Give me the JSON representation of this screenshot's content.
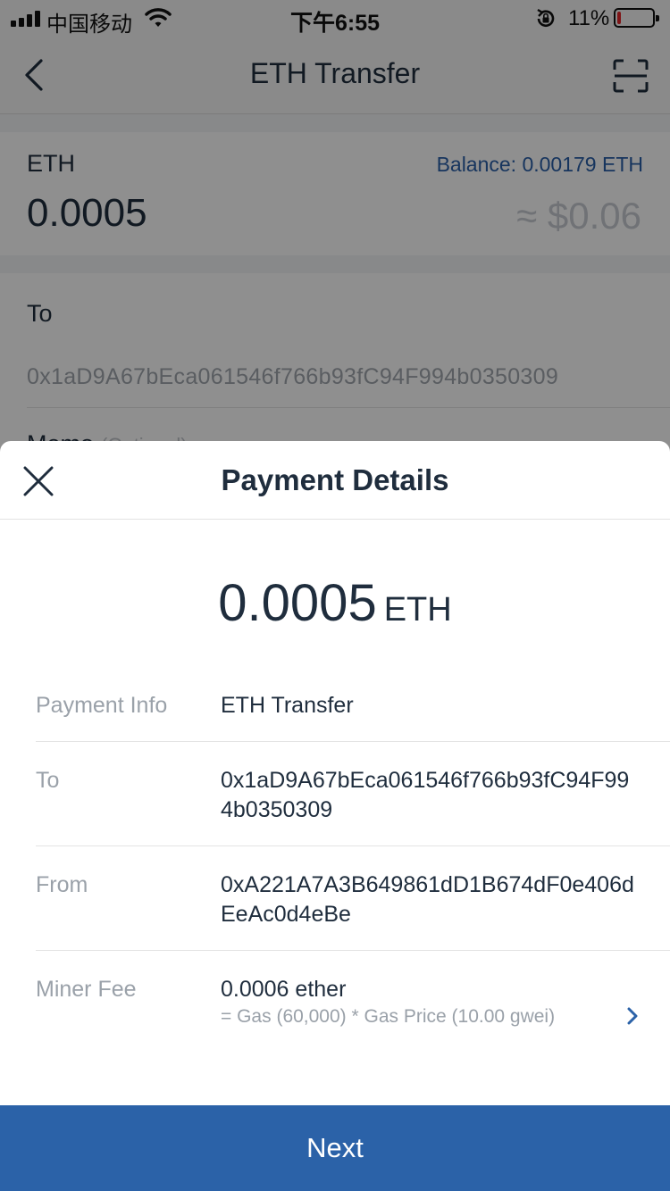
{
  "status_bar": {
    "carrier": "中国移动",
    "time": "下午6:55",
    "battery_percent": "11%",
    "battery_level": 0.11,
    "battery_color": "#e3262a"
  },
  "nav": {
    "back_icon": "chevron-left-icon",
    "title": "ETH Transfer",
    "scan_icon": "scan-icon"
  },
  "transfer_form": {
    "coin": "ETH",
    "balance": "Balance: 0.00179 ETH",
    "amount": "0.0005",
    "fiat_value": "≈ $0.06",
    "to_label": "To",
    "to_address": "0x1aD9A67bEca061546f766b93fC94F994b0350309",
    "memo_label": "Memo",
    "memo_hint": "(Optional)"
  },
  "payment_details": {
    "title": "Payment Details",
    "close_icon": "close-icon",
    "amount": "0.0005",
    "unit": "ETH",
    "rows": [
      {
        "label": "Payment Info",
        "value": "ETH Transfer"
      },
      {
        "label": "To",
        "value": "0x1aD9A67bEca061546f766b93fC94F994b0350309"
      },
      {
        "label": "From",
        "value": "0xA221A7A3B649861dD1B674dF0e406dEeAc0d4eBe"
      },
      {
        "label": "Miner Fee",
        "value": "0.0006 ether",
        "sub": "= Gas (60,000) * Gas Price (10.00 gwei)"
      }
    ],
    "fee_chevron_icon": "chevron-right-icon",
    "next_label": "Next"
  },
  "colors": {
    "accent": "#2b62a8",
    "balance_text": "#2a5fa8",
    "muted_text": "#9aa1a9",
    "primary_text": "#1f2d3d"
  }
}
